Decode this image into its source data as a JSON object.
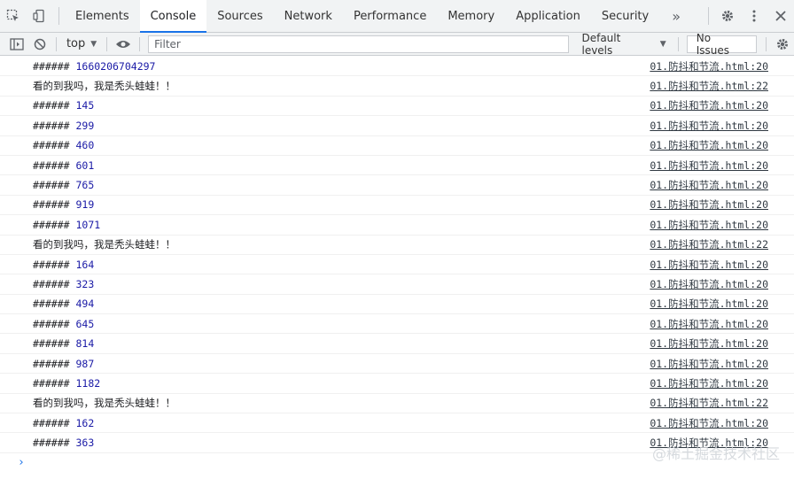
{
  "tabs": [
    {
      "label": "Elements",
      "active": false
    },
    {
      "label": "Console",
      "active": true
    },
    {
      "label": "Sources",
      "active": false
    },
    {
      "label": "Network",
      "active": false
    },
    {
      "label": "Performance",
      "active": false
    },
    {
      "label": "Memory",
      "active": false
    },
    {
      "label": "Application",
      "active": false
    },
    {
      "label": "Security",
      "active": false
    }
  ],
  "more_tabs": "»",
  "toolbar": {
    "context": "top",
    "filter_placeholder": "Filter",
    "levels": "Default levels",
    "issues": "No Issues"
  },
  "messages": [
    {
      "prefix": "###### ",
      "value": "1660206704297",
      "text": "",
      "source": "01.防抖和节流.html:20"
    },
    {
      "prefix": "",
      "value": "",
      "text": "看的到我吗，我是秃头蛙蛙！！",
      "source": "01.防抖和节流.html:22"
    },
    {
      "prefix": "###### ",
      "value": "145",
      "text": "",
      "source": "01.防抖和节流.html:20"
    },
    {
      "prefix": "###### ",
      "value": "299",
      "text": "",
      "source": "01.防抖和节流.html:20"
    },
    {
      "prefix": "###### ",
      "value": "460",
      "text": "",
      "source": "01.防抖和节流.html:20"
    },
    {
      "prefix": "###### ",
      "value": "601",
      "text": "",
      "source": "01.防抖和节流.html:20"
    },
    {
      "prefix": "###### ",
      "value": "765",
      "text": "",
      "source": "01.防抖和节流.html:20"
    },
    {
      "prefix": "###### ",
      "value": "919",
      "text": "",
      "source": "01.防抖和节流.html:20"
    },
    {
      "prefix": "###### ",
      "value": "1071",
      "text": "",
      "source": "01.防抖和节流.html:20"
    },
    {
      "prefix": "",
      "value": "",
      "text": "看的到我吗，我是秃头蛙蛙！！",
      "source": "01.防抖和节流.html:22"
    },
    {
      "prefix": "###### ",
      "value": "164",
      "text": "",
      "source": "01.防抖和节流.html:20"
    },
    {
      "prefix": "###### ",
      "value": "323",
      "text": "",
      "source": "01.防抖和节流.html:20"
    },
    {
      "prefix": "###### ",
      "value": "494",
      "text": "",
      "source": "01.防抖和节流.html:20"
    },
    {
      "prefix": "###### ",
      "value": "645",
      "text": "",
      "source": "01.防抖和节流.html:20"
    },
    {
      "prefix": "###### ",
      "value": "814",
      "text": "",
      "source": "01.防抖和节流.html:20"
    },
    {
      "prefix": "###### ",
      "value": "987",
      "text": "",
      "source": "01.防抖和节流.html:20"
    },
    {
      "prefix": "###### ",
      "value": "1182",
      "text": "",
      "source": "01.防抖和节流.html:20"
    },
    {
      "prefix": "",
      "value": "",
      "text": "看的到我吗，我是秃头蛙蛙！！",
      "source": "01.防抖和节流.html:22"
    },
    {
      "prefix": "###### ",
      "value": "162",
      "text": "",
      "source": "01.防抖和节流.html:20"
    },
    {
      "prefix": "###### ",
      "value": "363",
      "text": "",
      "source": "01.防抖和节流.html:20"
    }
  ],
  "prompt_symbol": "›",
  "watermark": "@稀土掘金技术社区"
}
